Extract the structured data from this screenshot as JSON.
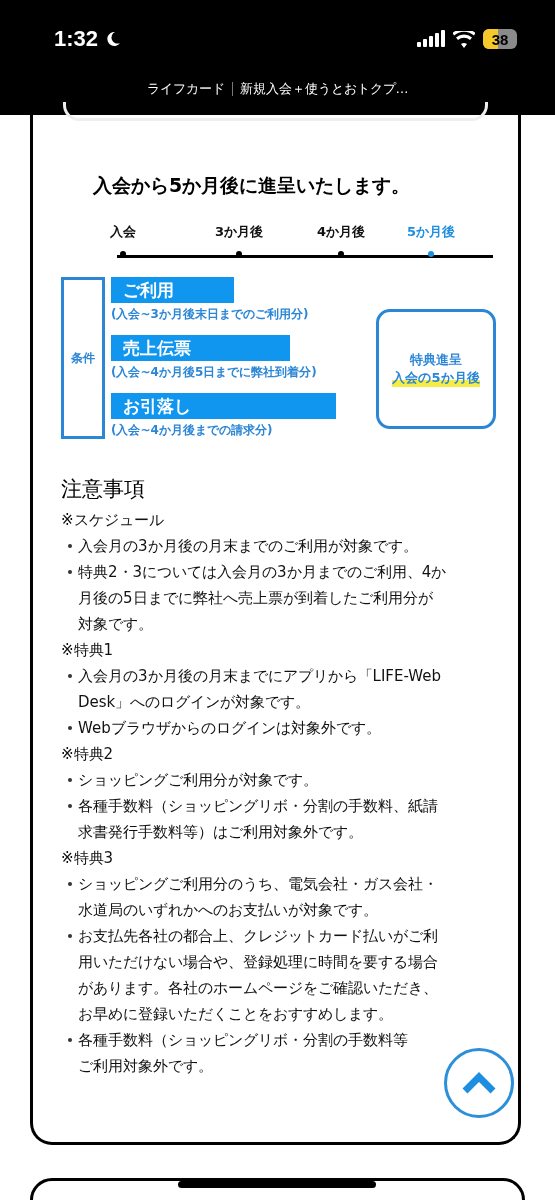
{
  "status_bar": {
    "time": "1:32",
    "battery": "38"
  },
  "browser": {
    "site": "ライフカード",
    "page_title": "新規入会＋使うとおトクプ…"
  },
  "heading": "入会から5か月後に進呈いたします。",
  "timeline": [
    {
      "label": "入会",
      "selected": false
    },
    {
      "label": "3か月後",
      "selected": false
    },
    {
      "label": "4か月後",
      "selected": false
    },
    {
      "label": "5か月後",
      "selected": true
    }
  ],
  "conditions": {
    "label": "条件",
    "items": [
      {
        "title": "ご利用",
        "note": "(入会~3か月後末日までのご利用分)"
      },
      {
        "title": "売上伝票",
        "note": "(入会~4か月後5日までに弊社到着分)"
      },
      {
        "title": "お引落し",
        "note": "(入会~4か月後までの請求分)"
      }
    ],
    "reward": {
      "line1": "特典進呈",
      "line2": "入会の5か月後"
    }
  },
  "notes": {
    "title": "注意事項",
    "items": [
      {
        "kind": "section",
        "text": "※スケジュール"
      },
      {
        "kind": "bullet",
        "lines": [
          "入会月の3か月後の月末までのご利用が対象です。"
        ]
      },
      {
        "kind": "bullet",
        "lines": [
          "特典2・3については入会月の3か月までのご利用、4か",
          "月後の5日までに弊社へ売上票が到着したご利用分が",
          "対象です。"
        ]
      },
      {
        "kind": "section",
        "text": "※特典1"
      },
      {
        "kind": "bullet",
        "lines": [
          "入会月の3か月後の月末までにアプリから「LIFE-Web",
          "Desk」へのログインが対象です。"
        ]
      },
      {
        "kind": "bullet",
        "lines": [
          "Webブラウザからのログインは対象外です。"
        ]
      },
      {
        "kind": "section",
        "text": "※特典2"
      },
      {
        "kind": "bullet",
        "lines": [
          "ショッピングご利用分が対象です。"
        ]
      },
      {
        "kind": "bullet",
        "lines": [
          "各種手数料（ショッピングリボ・分割の手数料、紙請",
          "求書発行手数料等）はご利用対象外です。"
        ]
      },
      {
        "kind": "section",
        "text": "※特典3"
      },
      {
        "kind": "bullet",
        "lines": [
          "ショッピングご利用分のうち、電気会社・ガス会社・",
          "水道局のいずれかへのお支払いが対象です。"
        ]
      },
      {
        "kind": "bullet",
        "lines": [
          "お支払先各社の都合上、クレジットカード払いがご利",
          "用いただけない場合や、登録処理に時間を要する場合",
          "があります。各社のホームページをご確認いただき、",
          "お早めに登録いただくことをおすすめします。"
        ]
      },
      {
        "kind": "bullet",
        "lines": [
          "各種手数料（ショッピングリボ・分割の手数料等",
          "ご利用対象外です。"
        ]
      }
    ]
  }
}
